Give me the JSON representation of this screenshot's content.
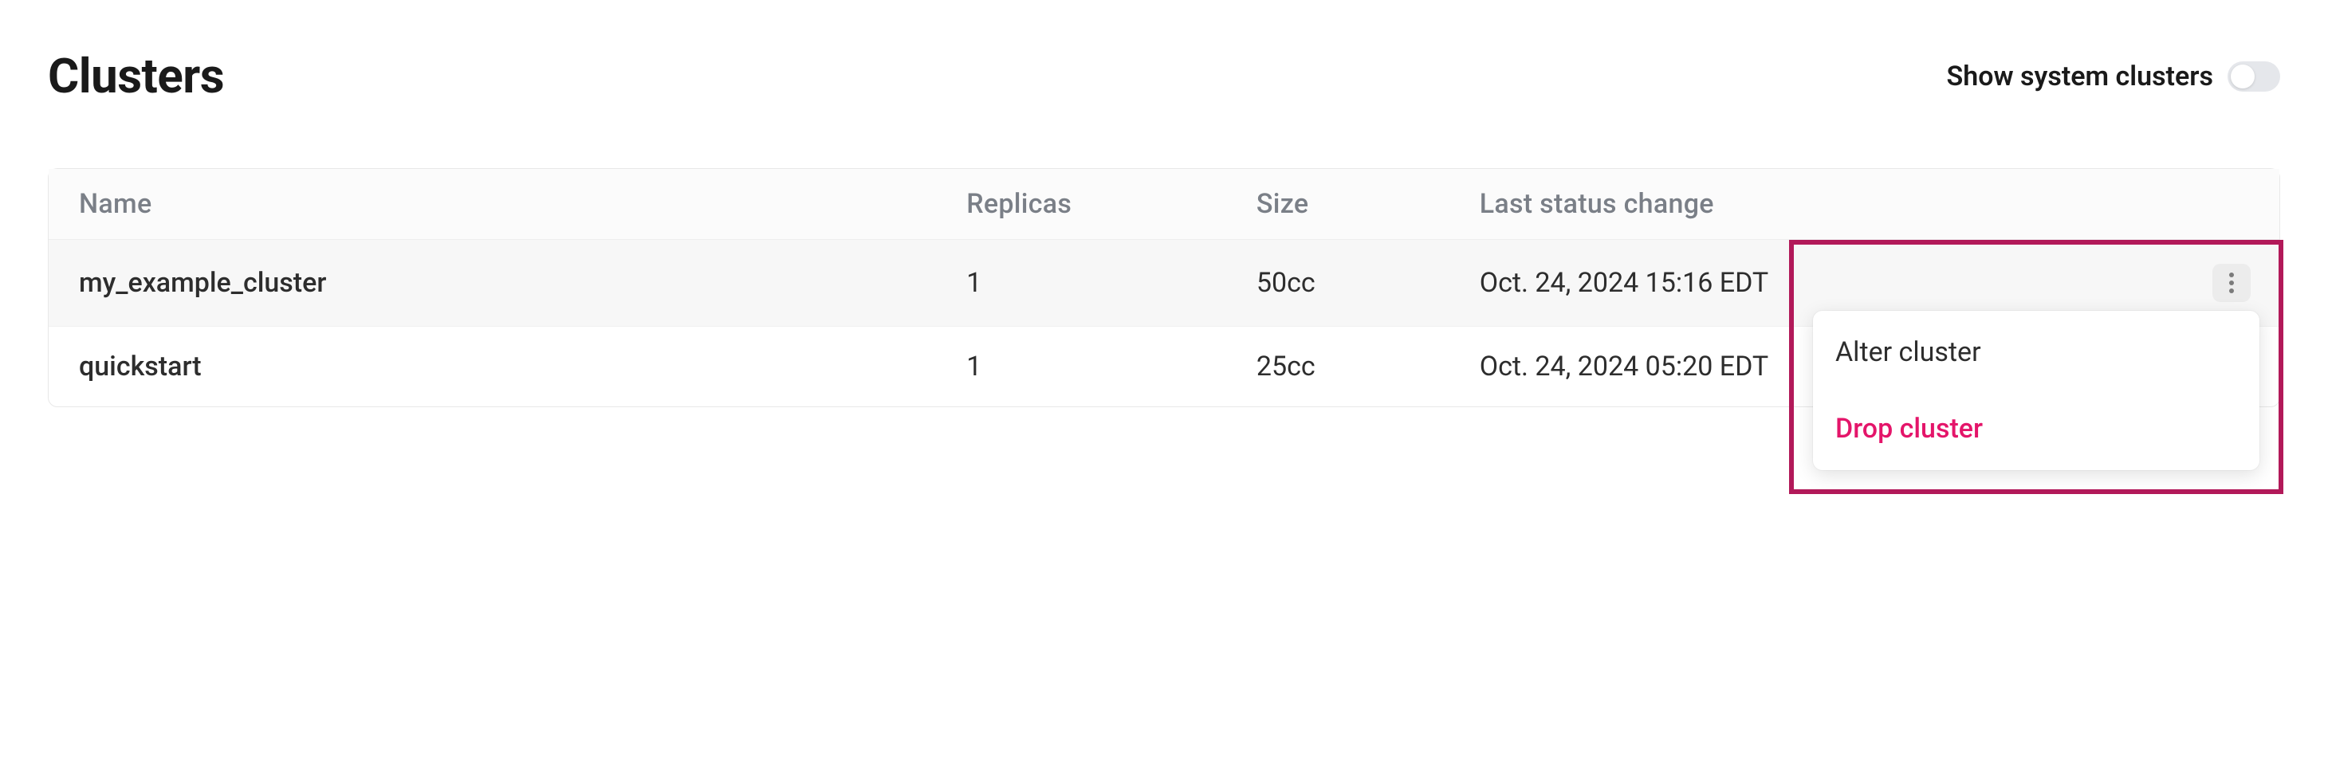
{
  "page": {
    "title": "Clusters"
  },
  "toggle": {
    "label": "Show system clusters",
    "checked": false
  },
  "table": {
    "columns": {
      "name": "Name",
      "replicas": "Replicas",
      "size": "Size",
      "last_status_change": "Last status change"
    },
    "rows": [
      {
        "name": "my_example_cluster",
        "replicas": "1",
        "size": "50cc",
        "last_status_change": "Oct. 24, 2024 15:16 EDT",
        "active": true
      },
      {
        "name": "quickstart",
        "replicas": "1",
        "size": "25cc",
        "last_status_change": "Oct. 24, 2024 05:20 EDT",
        "active": false
      }
    ]
  },
  "menu": {
    "alter": "Alter cluster",
    "drop": "Drop cluster"
  }
}
